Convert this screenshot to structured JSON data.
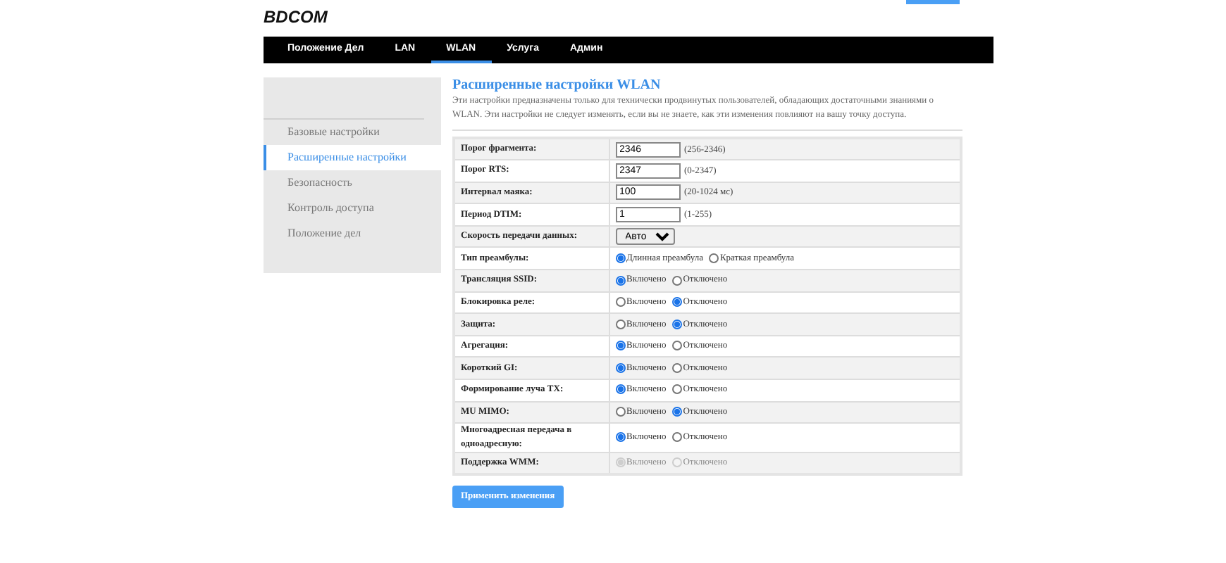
{
  "logo": {
    "text": "BDCOM"
  },
  "nav": [
    {
      "label": "Положение Дел",
      "selected": false
    },
    {
      "label": "LAN",
      "selected": false
    },
    {
      "label": "WLAN",
      "selected": true
    },
    {
      "label": "Услуга",
      "selected": false
    },
    {
      "label": "Админ",
      "selected": false
    }
  ],
  "sidebar": {
    "items": [
      {
        "label": "Базовые настройки",
        "selected": false
      },
      {
        "label": "Расширенные настройки",
        "selected": true
      },
      {
        "label": "Безопасность",
        "selected": false
      },
      {
        "label": "Контроль доступа",
        "selected": false
      },
      {
        "label": "Положение дел",
        "selected": false
      }
    ]
  },
  "page": {
    "title": "Расширенные настройки WLAN",
    "description": "Эти настройки предназначены только для технически продвинутых пользователей, обладающих достаточными знаниями о WLAN. Эти настройки не следует изменять, если вы не знаете, как эти изменения повлияют на вашу точку доступа."
  },
  "rows": [
    {
      "kind": "text",
      "label": "Порог фрагмента:",
      "value": "2346",
      "hint": "(256-2346)"
    },
    {
      "kind": "text",
      "label": "Порог RTS:",
      "value": "2347",
      "hint": "(0-2347)"
    },
    {
      "kind": "text",
      "label": "Интервал маяка:",
      "value": "100",
      "hint": "(20-1024 мс)"
    },
    {
      "kind": "text",
      "label": "Период DTIM:",
      "value": "1",
      "hint": "(1-255)"
    },
    {
      "kind": "select",
      "label": "Скорость передачи данных:",
      "value": "Авто"
    },
    {
      "kind": "radio",
      "label": "Тип преамбулы:",
      "options": [
        {
          "label": "Длинная преамбула",
          "checked": true,
          "disabled": false
        },
        {
          "label": "Краткая преамбула",
          "checked": false,
          "disabled": false
        }
      ]
    },
    {
      "kind": "radio",
      "label": "Трансляция SSID:",
      "options": [
        {
          "label": "Включено",
          "checked": true,
          "disabled": false
        },
        {
          "label": "Отключено",
          "checked": false,
          "disabled": false
        }
      ]
    },
    {
      "kind": "radio",
      "label": "Блокировка реле:",
      "options": [
        {
          "label": "Включено",
          "checked": false,
          "disabled": false
        },
        {
          "label": "Отключено",
          "checked": true,
          "disabled": false
        }
      ]
    },
    {
      "kind": "radio",
      "label": "Защита:",
      "options": [
        {
          "label": "Включено",
          "checked": false,
          "disabled": false
        },
        {
          "label": "Отключено",
          "checked": true,
          "disabled": false
        }
      ]
    },
    {
      "kind": "radio",
      "label": "Агрегация:",
      "options": [
        {
          "label": "Включено",
          "checked": true,
          "disabled": false
        },
        {
          "label": "Отключено",
          "checked": false,
          "disabled": false
        }
      ]
    },
    {
      "kind": "radio",
      "label": "Короткий GI:",
      "options": [
        {
          "label": "Включено",
          "checked": true,
          "disabled": false
        },
        {
          "label": "Отключено",
          "checked": false,
          "disabled": false
        }
      ]
    },
    {
      "kind": "radio",
      "label": "Формирование луча TX:",
      "options": [
        {
          "label": "Включено",
          "checked": true,
          "disabled": false
        },
        {
          "label": "Отключено",
          "checked": false,
          "disabled": false
        }
      ]
    },
    {
      "kind": "radio",
      "label": "MU MIMO:",
      "options": [
        {
          "label": "Включено",
          "checked": false,
          "disabled": false
        },
        {
          "label": "Отключено",
          "checked": true,
          "disabled": false
        }
      ]
    },
    {
      "kind": "radio",
      "label": "Многоадресная передача в одноадресную:",
      "options": [
        {
          "label": "Включено",
          "checked": true,
          "disabled": false
        },
        {
          "label": "Отключено",
          "checked": false,
          "disabled": false
        }
      ]
    },
    {
      "kind": "radio",
      "label": "Поддержка WMM:",
      "options": [
        {
          "label": "Включено",
          "checked": true,
          "disabled": true
        },
        {
          "label": "Отключено",
          "checked": false,
          "disabled": true
        }
      ]
    }
  ],
  "apply_button": "Применить изменения"
}
